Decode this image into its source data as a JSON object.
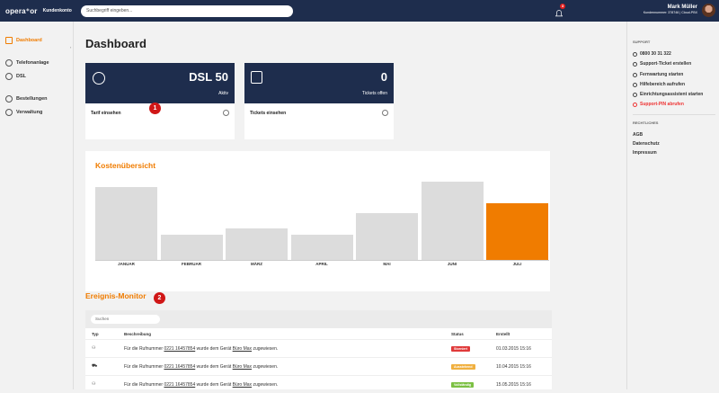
{
  "header": {
    "logo": "opera⁺or",
    "app_name": "Kundenkonto",
    "search_placeholder": "Suchbegriff eingeben...",
    "notification_count": "3",
    "user_name": "Mark Müller",
    "user_sub": "Kundennummer: 378746 | Cloud-PBX"
  },
  "sidebar": {
    "collapse_glyph": "‹",
    "items": [
      {
        "label": "Dashboard",
        "icon": "dashboard-icon"
      },
      {
        "label": "Telefonanlage",
        "icon": "phone-icon"
      },
      {
        "label": "DSL",
        "icon": "wifi-icon"
      },
      {
        "label": "Bestellungen",
        "icon": "star-icon"
      },
      {
        "label": "Verwaltung",
        "icon": "user-icon"
      }
    ]
  },
  "page_title": "Dashboard",
  "cards": [
    {
      "value": "DSL 50",
      "sub": "Aktiv",
      "link": "Tarif einsehen",
      "icon": "phone-icon"
    },
    {
      "value": "0",
      "sub": "Tickets offen",
      "link": "Tickets einsehen",
      "icon": "ticket-icon"
    }
  ],
  "markers": [
    "1",
    "2"
  ],
  "chart_title": "Kostenübersicht",
  "chart_data": {
    "type": "bar",
    "title": "Kostenübersicht",
    "categories": [
      "JANUAR",
      "FEBRUAR",
      "MÄRZ",
      "APRIL",
      "MAI",
      "JUNI",
      "JULI"
    ],
    "values": [
      85,
      29,
      37,
      29,
      55,
      92,
      66
    ],
    "ylim": [
      0,
      100
    ],
    "highlight_index": 6,
    "colors": {
      "default": "#dcdcdc",
      "highlight": "#f07c00"
    }
  },
  "events": {
    "title": "Ereignis-Monitor",
    "search_placeholder": "Suchen",
    "headers": [
      "Typ",
      "Beschreibung",
      "Status",
      "Erstellt"
    ],
    "rows": [
      {
        "icon": "user-icon",
        "pre": "Für die Rufnummer",
        "number": "0221 16457854",
        "mid": "wurde dem Gerät",
        "device": "Büro Max",
        "post": "zugewiesen.",
        "status": "Storniert",
        "status_color": "#e03a3a",
        "date": "01.03.2015 15:16"
      },
      {
        "icon": "truck-icon",
        "pre": "Für die Rufnummer",
        "number": "0221 16457854",
        "mid": "wurde dem Gerät",
        "device": "Büro Max",
        "post": "zugewiesen.",
        "status": "Ausstehend",
        "status_color": "#f0b040",
        "date": "10.04.2015 15:16"
      },
      {
        "icon": "user-icon",
        "pre": "Für die Rufnummer",
        "number": "0221 16457854",
        "mid": "wurde dem Gerät",
        "device": "Büro Max",
        "post": "zugewiesen.",
        "status": "Vollständig",
        "status_color": "#7cc043",
        "date": "15.05.2015 15:16"
      }
    ]
  },
  "right": {
    "support_head": "SUPPORT",
    "support": [
      {
        "label": "0800 30 31 322",
        "icon": "phone-icon"
      },
      {
        "label": "Support-Ticket erstellen",
        "icon": "ticket-icon"
      },
      {
        "label": "Fernwartung starten",
        "icon": "remote-icon"
      },
      {
        "label": "Hilfebereich aufrufen",
        "icon": "help-icon"
      },
      {
        "label": "Einrichtungsassistent starten",
        "icon": "wrench-icon"
      },
      {
        "label": "Support-PIN abrufen",
        "icon": "shield-icon"
      }
    ],
    "legal_head": "RECHTLICHES",
    "legal": [
      "AGB",
      "Datenschutz",
      "Impressum"
    ]
  }
}
